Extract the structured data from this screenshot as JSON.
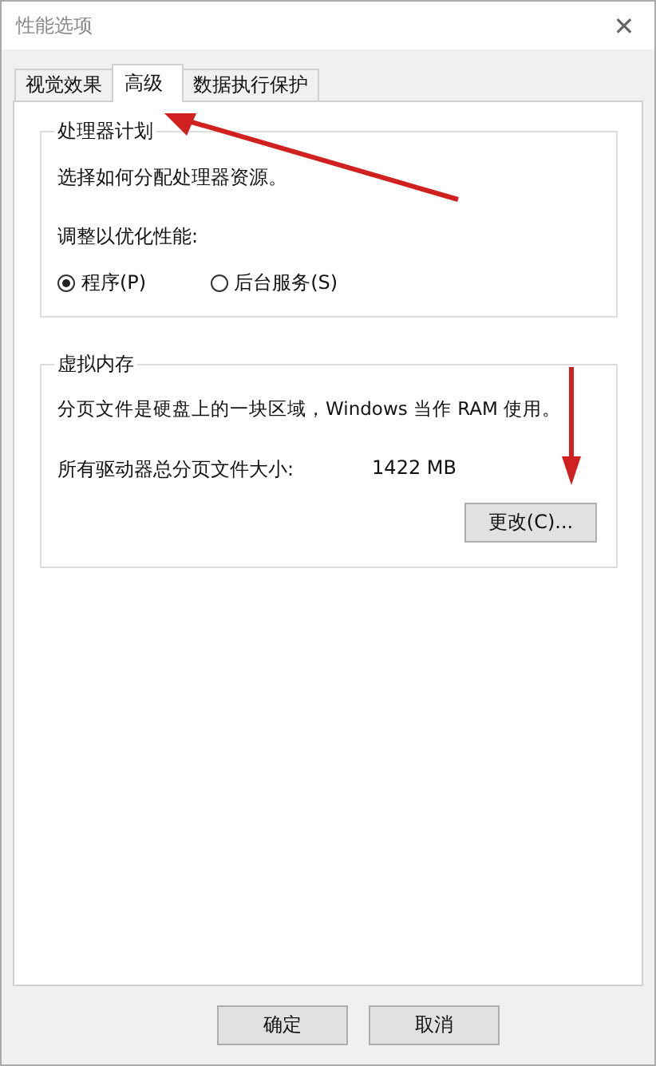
{
  "window": {
    "title": "性能选项",
    "close": "✕"
  },
  "tabs": [
    {
      "label": "视觉效果",
      "selected": false
    },
    {
      "label": "高级",
      "selected": true
    },
    {
      "label": "数据执行保护",
      "selected": false
    }
  ],
  "processor_group": {
    "title": "处理器计划",
    "description": "选择如何分配处理器资源。",
    "prompt": "调整以优化性能:",
    "options": [
      {
        "label": "程序(P)",
        "selected": true
      },
      {
        "label": "后台服务(S)",
        "selected": false
      }
    ]
  },
  "memory_group": {
    "title": "虚拟内存",
    "description": "分页文件是硬盘上的一块区域，Windows 当作 RAM 使用。",
    "size_label": "所有驱动器总分页文件大小:",
    "size_value": "1422 MB",
    "button": "更改(C)..."
  },
  "buttons": [
    "确定",
    "取消"
  ]
}
